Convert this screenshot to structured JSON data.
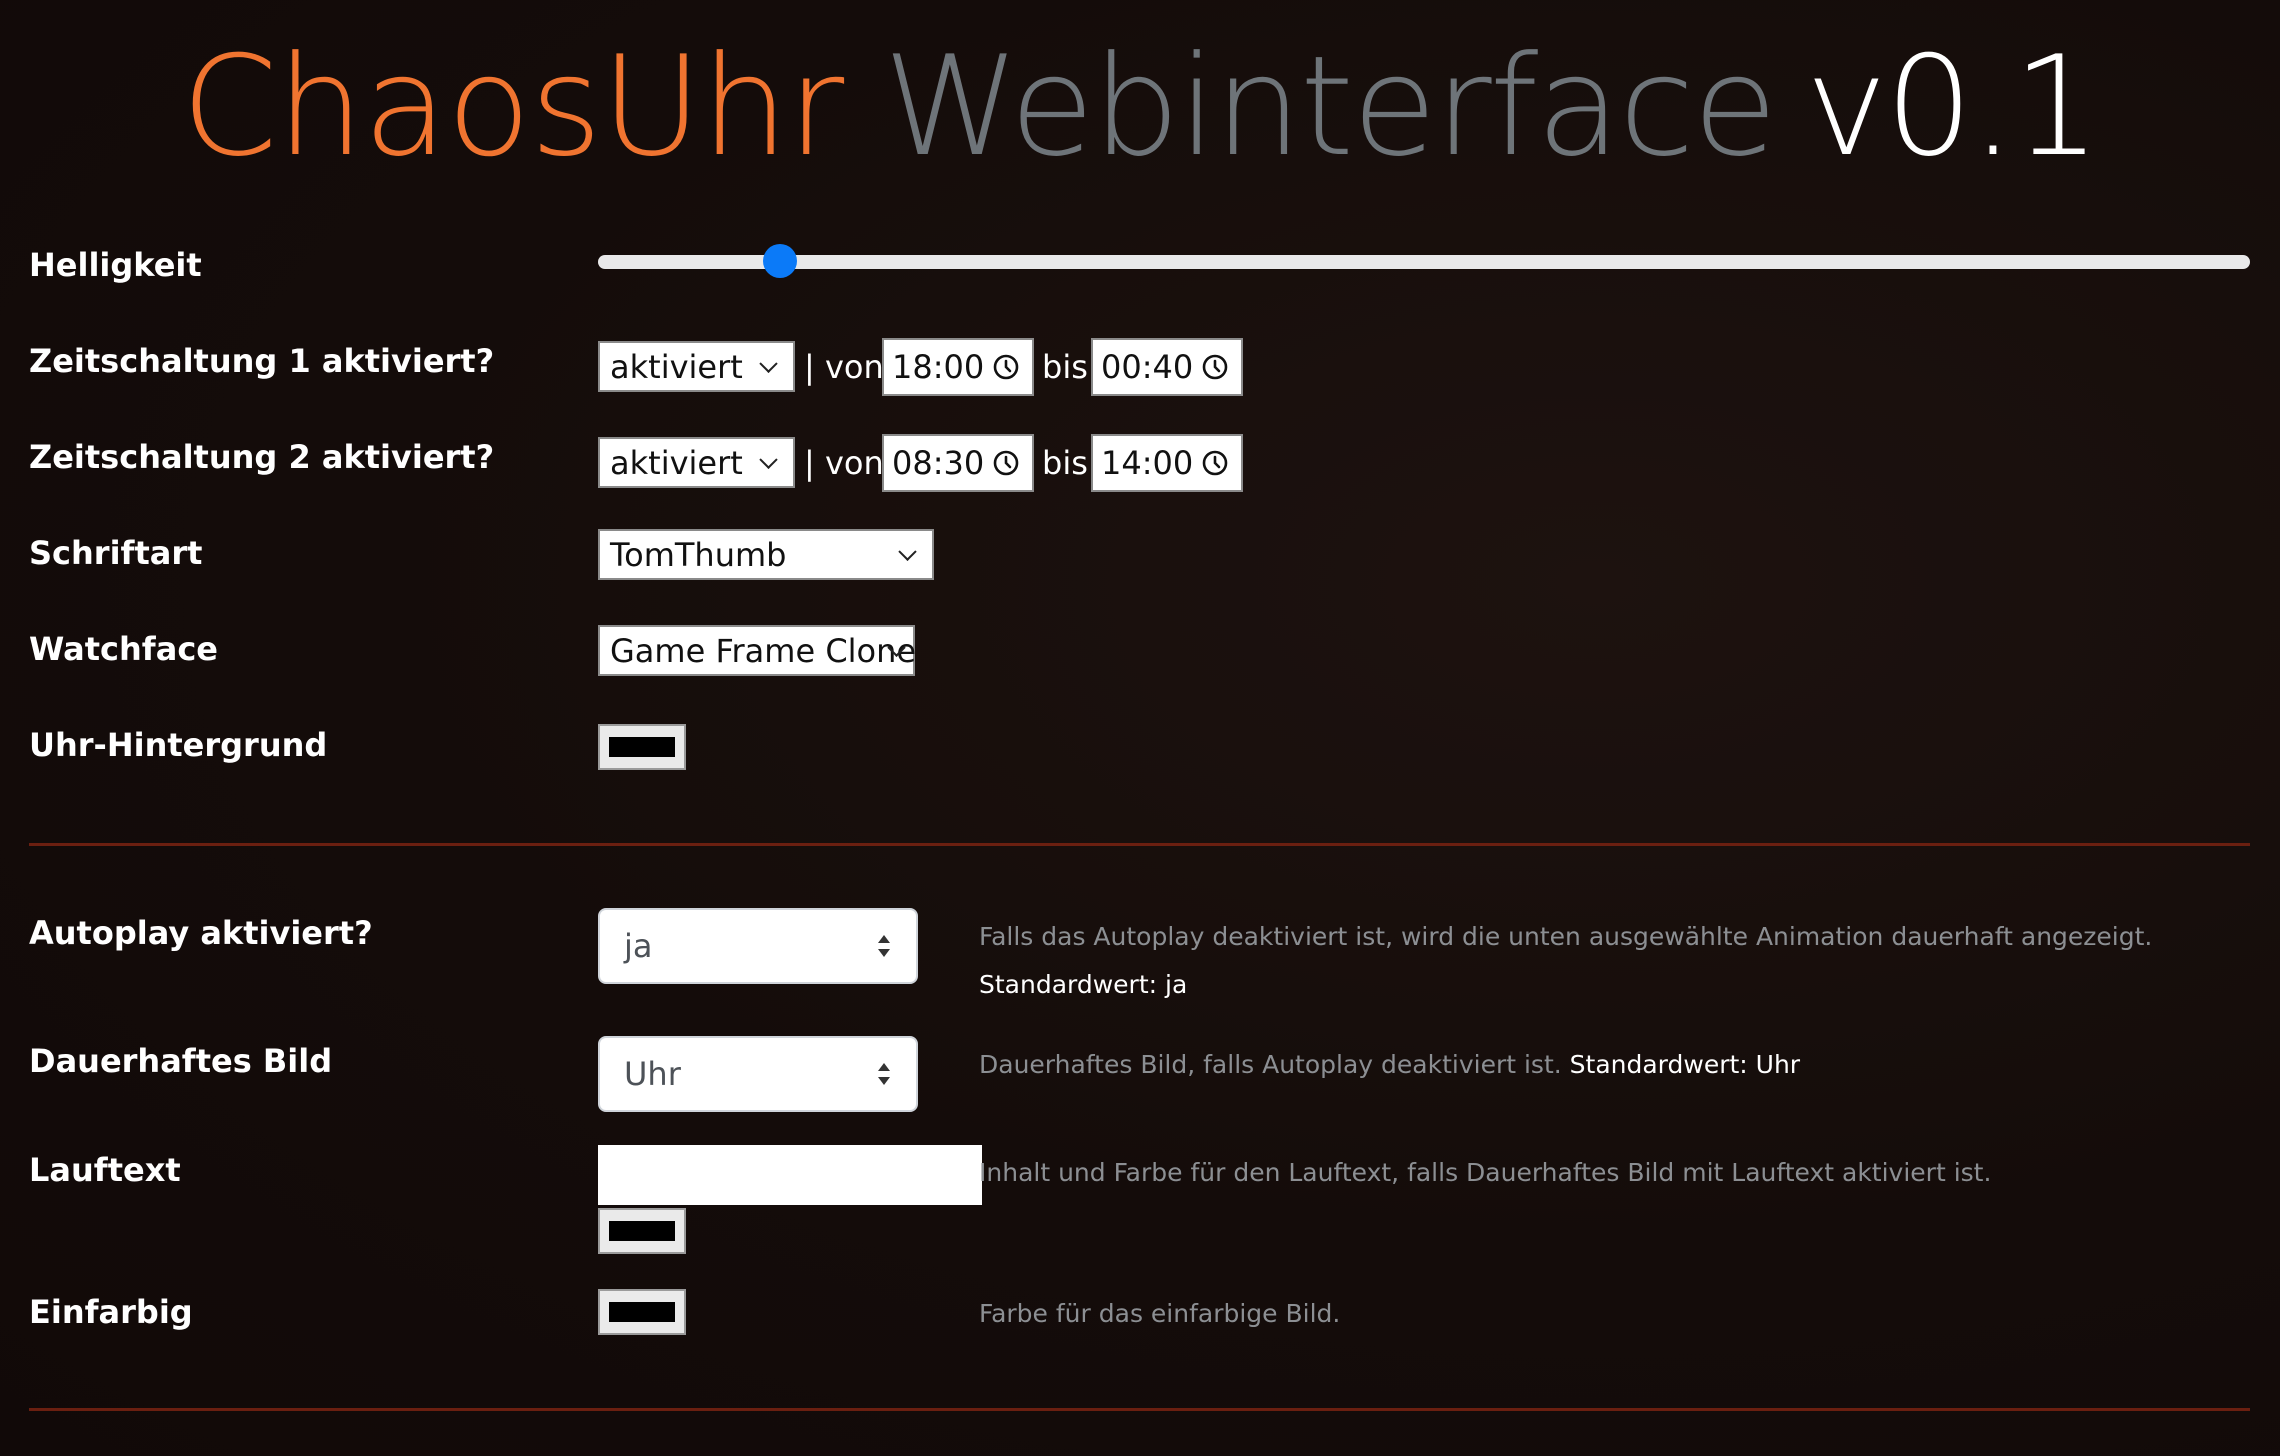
{
  "header": {
    "title_part1": "ChaosUhr",
    "title_part2": "Webinterface",
    "title_part3": "v0.1",
    "colors": {
      "brand": "#f07430",
      "muted": "#6e7479",
      "accent_blue": "#0b7af8",
      "divider": "#6b1f10"
    }
  },
  "brightness": {
    "label": "Helligkeit",
    "value_fraction": 0.11
  },
  "timer1": {
    "label": "Zeitschaltung 1 aktiviert?",
    "state": "aktiviert",
    "from_label": "| von",
    "from": "18:00",
    "to_label": "bis",
    "to": "00:40"
  },
  "timer2": {
    "label": "Zeitschaltung 2 aktiviert?",
    "state": "aktiviert",
    "from_label": "| von",
    "from": "08:30",
    "to_label": "bis",
    "to": "14:00"
  },
  "font": {
    "label": "Schriftart",
    "value": "TomThumb"
  },
  "watchface": {
    "label": "Watchface",
    "value": "Game Frame Clone"
  },
  "clock_bg": {
    "label": "Uhr-Hintergrund",
    "color": "#000000"
  },
  "autoplay": {
    "label": "Autoplay aktiviert?",
    "value": "ja",
    "help": "Falls das Autoplay deaktiviert ist, wird die unten ausgewählte Animation dauerhaft angezeigt.",
    "default": "Standardwert: ja"
  },
  "permanent_image": {
    "label": "Dauerhaftes Bild",
    "value": "Uhr",
    "help": "Dauerhaftes Bild, falls Autoplay deaktiviert ist.",
    "default": "Standardwert: Uhr"
  },
  "scroll_text": {
    "label": "Lauftext",
    "value": "",
    "help": "Inhalt und Farbe für den Lauftext, falls Dauerhaftes Bild mit Lauftext aktiviert ist.",
    "color": "#000000"
  },
  "solid_color": {
    "label": "Einfarbig",
    "help": "Farbe für das einfarbige Bild.",
    "color": "#000000"
  }
}
